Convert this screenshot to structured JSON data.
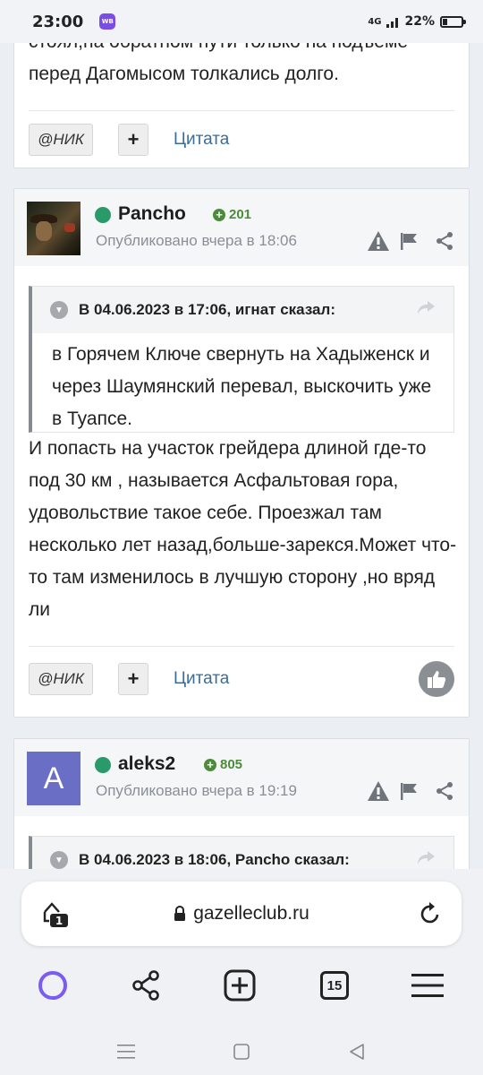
{
  "status_bar": {
    "time": "23:00",
    "app_badge": "WB",
    "signal": "4G",
    "battery": "22%"
  },
  "posts": [
    {
      "text": "стоял,на обратном пути только на подъеме перед Дагомысом толкались долго.",
      "actions": {
        "nick": "@НИК",
        "plus": "+",
        "quote": "Цитата"
      }
    },
    {
      "author": "Pancho",
      "reputation": "201",
      "published": "Опубликовано вчера в 18:06",
      "quote": {
        "cite": "В 04.06.2023 в 17:06, игнат сказал:",
        "text": "в Горячем Ключе свернуть на Хадыженск и через Шаумянский перевал, выскочить уже в Туапсе."
      },
      "text": "И попасть на участок грейдера длиной где-то под 30 км , называется Асфальтовая гора, удовольствие такое себе. Проезжал там несколько лет назад,больше-зарекся.Может что-то там изменилось в лучшую сторону ,но вряд ли",
      "actions": {
        "nick": "@НИК",
        "plus": "+",
        "quote": "Цитата"
      }
    },
    {
      "author": "aleks2",
      "avatar_letter": "A",
      "reputation": "805",
      "published": "Опубликовано вчера в 19:19",
      "quote": {
        "cite": "В 04.06.2023 в 18:06, Pancho сказал:"
      }
    }
  ],
  "browser": {
    "url": "gazelleclub.ru",
    "tab_badge": "1",
    "tab_count": "15"
  },
  "colors": {
    "online": "#2a9a6a",
    "reputation": "#4c8b3a",
    "link": "#3a6d99",
    "alice": "#7b5cf0"
  }
}
